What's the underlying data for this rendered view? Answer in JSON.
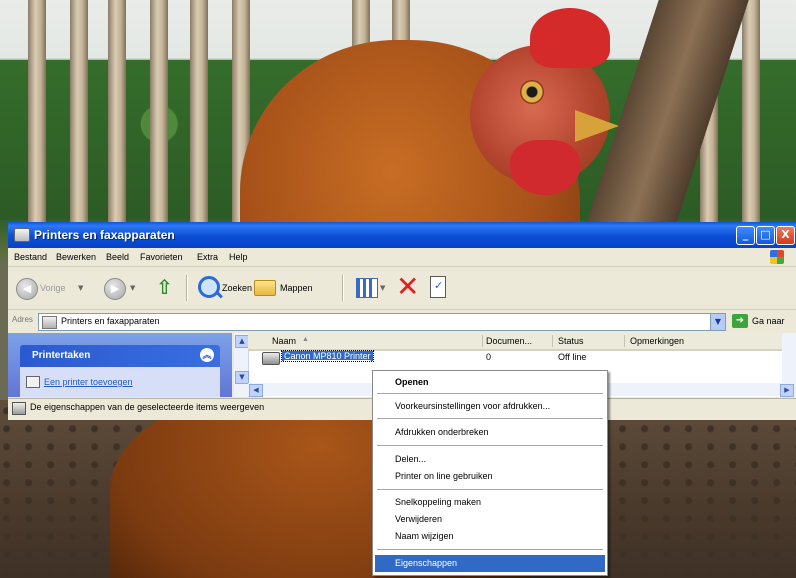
{
  "window": {
    "title": "Printers en faxapparaten",
    "controls": {
      "minimize": "_",
      "maximize": "□",
      "close": "X"
    }
  },
  "menubar": [
    "Bestand",
    "Bewerken",
    "Beeld",
    "Favorieten",
    "Extra",
    "Help"
  ],
  "toolbar": {
    "back_label": "Vorige",
    "search_label": "Zoeken",
    "folders_label": "Mappen"
  },
  "address": {
    "label": "Adres",
    "value": "Printers en faxapparaten",
    "go_label": "Ga naar"
  },
  "taskpane": {
    "header": "Printertaken",
    "links": [
      "Een printer toevoegen"
    ]
  },
  "list": {
    "columns": [
      "Naam",
      "Documen...",
      "Status",
      "Opmerkingen"
    ],
    "rows": [
      {
        "name": "Canon MP810 Printer",
        "documents": "0",
        "status": "Off line",
        "comments": ""
      }
    ]
  },
  "statusbar": {
    "text": "De eigenschappen van de geselecteerde items weergeven"
  },
  "context_menu": {
    "groups": [
      [
        "Openen"
      ],
      [
        "Voorkeursinstellingen voor afdrukken..."
      ],
      [
        "Afdrukken onderbreken"
      ],
      [
        "Delen...",
        "Printer on line gebruiken"
      ],
      [
        "Snelkoppeling maken",
        "Verwijderen",
        "Naam wijzigen"
      ],
      [
        "Eigenschappen"
      ]
    ],
    "default_item": "Openen",
    "highlighted_item": "Eigenschappen"
  },
  "colors": {
    "titlebar": "#0a56e6",
    "selection": "#316ac5",
    "taskpane": "#6375d6"
  },
  "icons": {
    "back": "back-arrow-icon",
    "forward": "forward-arrow-icon",
    "up": "folder-up-icon",
    "search": "search-icon",
    "folders": "folders-icon",
    "views": "views-icon",
    "delete": "delete-icon",
    "properties": "properties-icon"
  }
}
